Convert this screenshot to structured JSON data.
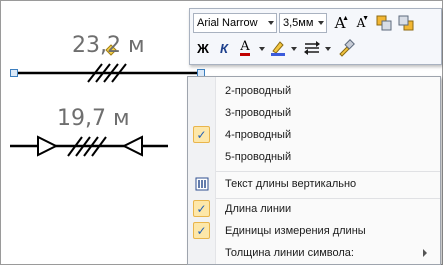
{
  "drawing": {
    "measure_top": "23,2 м",
    "measure_bottom": "19,7 м"
  },
  "toolbar": {
    "font_name": "Arial Narrow",
    "font_size": "3,5мм",
    "buttons": [
      {
        "icon": "grow-font-icon",
        "glyph": "A"
      },
      {
        "icon": "shrink-font-icon",
        "glyph": "A"
      },
      {
        "icon": "bring-forward-icon"
      },
      {
        "icon": "send-backward-icon"
      },
      {
        "icon": "bold-icon",
        "glyph": "Ж"
      },
      {
        "icon": "italic-icon",
        "glyph": "К"
      },
      {
        "icon": "font-color-icon",
        "glyph": "A"
      },
      {
        "icon": "highlight-icon"
      },
      {
        "icon": "line-style-icon"
      },
      {
        "icon": "format-painter-icon"
      }
    ],
    "colors": {
      "font_color": "#c00000",
      "highlight": "#3b5bdb"
    }
  },
  "menu": {
    "items": [
      {
        "label": "2-проводный",
        "checked": false
      },
      {
        "label": "3-проводный",
        "checked": false
      },
      {
        "label": "4-проводный",
        "checked": true
      },
      {
        "label": "5-проводный",
        "checked": false
      },
      {
        "label": "Текст длины вертикально",
        "icon": "vertical-text-icon"
      },
      {
        "label": "Длина линии",
        "checked": true
      },
      {
        "label": "Единицы измерения длины",
        "checked": true
      },
      {
        "label": "Толщина линии символа:",
        "submenu": true
      }
    ],
    "check_glyph": "✓"
  }
}
